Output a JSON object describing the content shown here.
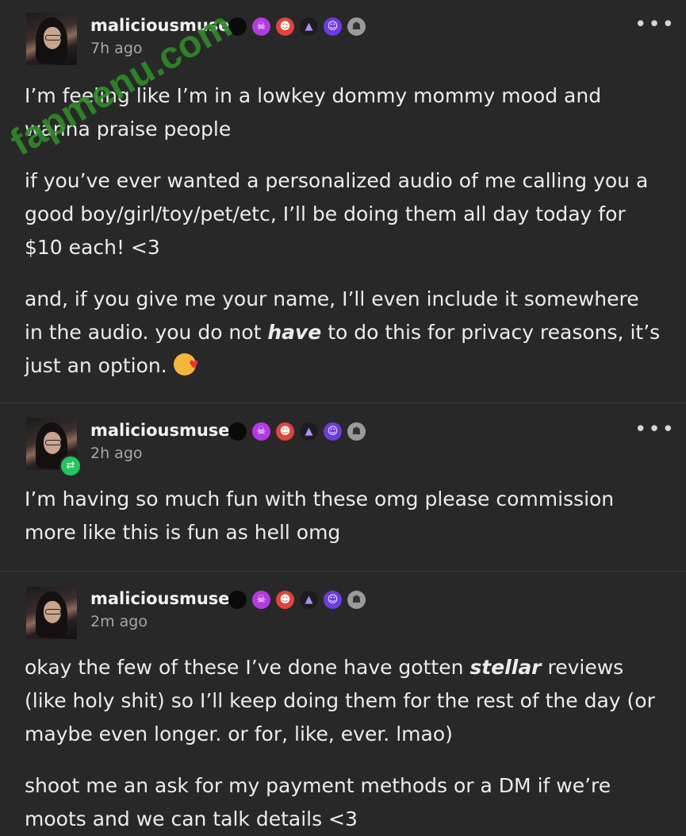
{
  "posts": [
    {
      "username": "maliciousmuse",
      "time": "7h ago",
      "more": "•••",
      "paragraphs": [
        "I’m feeling like I’m in a lowkey dommy mommy mood and wanna praise people",
        "if you’ve ever wanted a personalized audio of me calling you a good boy/girl/toy/pet/etc, I’ll be doing them all day today for $10 each! <3"
      ],
      "p3_before": "and, if you give me your name, I’ll even include it somewhere in the audio. you do not ",
      "p3_em": "have",
      "p3_after": " to do this for privacy reasons, it’s just an option. "
    },
    {
      "username": "maliciousmuse",
      "time": "2h ago",
      "more": "•••",
      "paragraphs": [
        "I’m having so much fun with these omg please commission more like this is fun as hell omg"
      ]
    },
    {
      "username": "maliciousmuse",
      "time": "2m ago",
      "p1_before": "okay the few of these I’ve done have gotten ",
      "p1_em": "stellar",
      "p1_after": " reviews (like holy shit) so I’ll keep doing them for the rest of the day (or maybe even longer. or for, like, ever. lmao)",
      "p2": "shoot me an ask for my payment methods or a DM if we’re moots and we can talk details <3"
    }
  ],
  "watermark": "fapmenu.com",
  "icons": [
    "avatar",
    "black-dot-icon",
    "skull-icon",
    "demon-icon",
    "witch-icon",
    "ghost-icon",
    "statue-icon",
    "reblog-icon",
    "more-icon",
    "smiling-hearts-emoji"
  ]
}
